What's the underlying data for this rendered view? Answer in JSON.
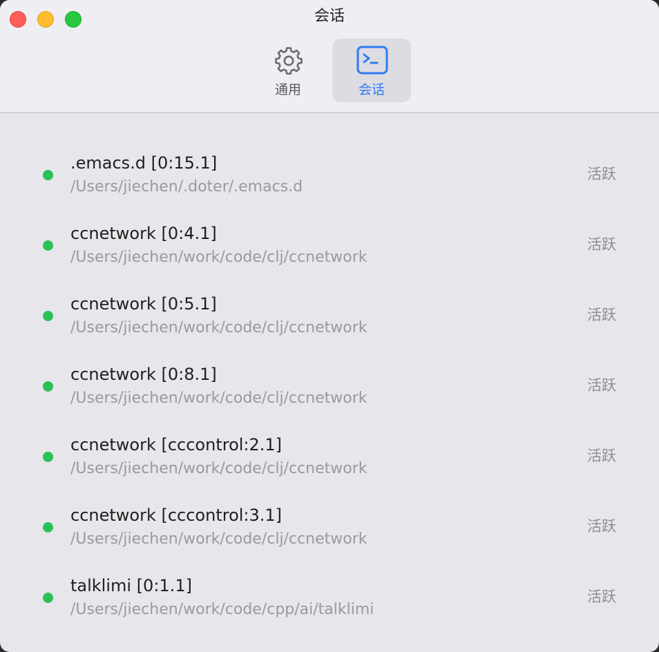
{
  "window": {
    "title": "会话"
  },
  "toolbar": {
    "tabs": [
      {
        "label": "通用",
        "icon": "gear-icon",
        "selected": false
      },
      {
        "label": "会话",
        "icon": "terminal-icon",
        "selected": true
      }
    ]
  },
  "colors": {
    "accent": "#2f7bf5",
    "active_dot": "#2ac157"
  },
  "sessions": [
    {
      "name": ".emacs.d [0:15.1]",
      "path": "/Users/jiechen/.doter/.emacs.d",
      "status": "活跃"
    },
    {
      "name": "ccnetwork [0:4.1]",
      "path": "/Users/jiechen/work/code/clj/ccnetwork",
      "status": "活跃"
    },
    {
      "name": "ccnetwork [0:5.1]",
      "path": "/Users/jiechen/work/code/clj/ccnetwork",
      "status": "活跃"
    },
    {
      "name": "ccnetwork [0:8.1]",
      "path": "/Users/jiechen/work/code/clj/ccnetwork",
      "status": "活跃"
    },
    {
      "name": "ccnetwork [cccontrol:2.1]",
      "path": "/Users/jiechen/work/code/clj/ccnetwork",
      "status": "活跃"
    },
    {
      "name": "ccnetwork [cccontrol:3.1]",
      "path": "/Users/jiechen/work/code/clj/ccnetwork",
      "status": "活跃"
    },
    {
      "name": "talklimi [0:1.1]",
      "path": "/Users/jiechen/work/code/cpp/ai/talklimi",
      "status": "活跃"
    }
  ]
}
